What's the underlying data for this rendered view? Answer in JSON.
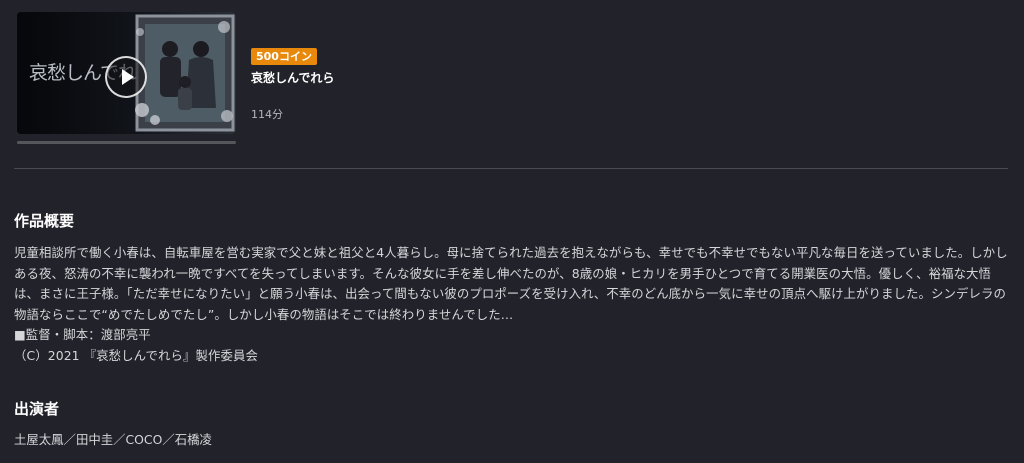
{
  "episode": {
    "price_badge": "500コイン",
    "title": "哀愁しんでれら",
    "duration": "114分",
    "thumbnail_caption": "哀愁しんでれ",
    "progress": 0.0
  },
  "overview": {
    "heading": "作品概要",
    "synopsis": "児童相談所で働く小春は、自転車屋を営む実家で父と妹と祖父と4人暮らし。母に捨てられた過去を抱えながらも、幸せでも不幸せでもない平凡な毎日を送っていました。しかしある夜、怒涛の不幸に襲われ一晩ですべてを失ってしまいます。そんな彼女に手を差し伸べたのが、8歳の娘・ヒカリを男手ひとつで育てる開業医の大悟。優しく、裕福な大悟は、まさに王子様。「ただ幸せになりたい」と願う小春は、出会って間もない彼のプロポーズを受け入れ、不幸のどん底から一気に幸せの頂点へ駆け上がりました。シンデレラの物語ならここで“めでたしめでたし”。しかし小春の物語はそこでは終わりませんでした…",
    "director": "■監督・脚本：渡部亮平",
    "copyright": "（C）2021 『哀愁しんでれら』製作委員会"
  },
  "cast": {
    "heading": "出演者",
    "names": "土屋太鳳／田中圭／COCO／石橋凌"
  },
  "colors": {
    "background": "#22222a",
    "badge": "#e8890c",
    "divider": "#4a4a52"
  }
}
